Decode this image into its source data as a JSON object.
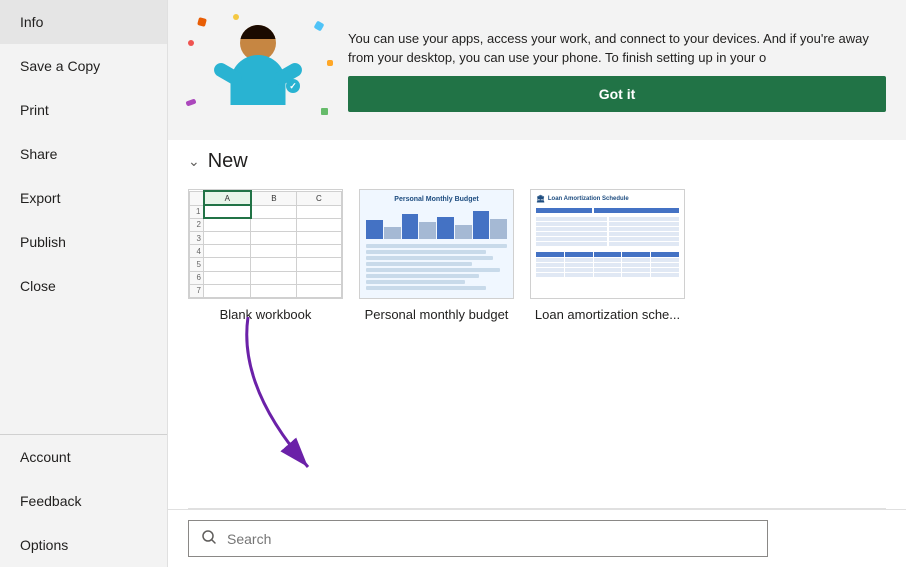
{
  "sidebar": {
    "items": [
      {
        "id": "info",
        "label": "Info"
      },
      {
        "id": "save-copy",
        "label": "Save a Copy"
      },
      {
        "id": "print",
        "label": "Print"
      },
      {
        "id": "share",
        "label": "Share"
      },
      {
        "id": "export",
        "label": "Export"
      },
      {
        "id": "publish",
        "label": "Publish"
      },
      {
        "id": "close",
        "label": "Close"
      }
    ],
    "bottom_items": [
      {
        "id": "account",
        "label": "Account"
      },
      {
        "id": "feedback",
        "label": "Feedback"
      },
      {
        "id": "options",
        "label": "Options"
      }
    ]
  },
  "banner": {
    "text": "You can use your apps, access your work, and connect to your devices. And if you're away from your desktop, you can use your phone. To finish setting up in your o",
    "got_it_label": "Got it"
  },
  "new_section": {
    "header": "New",
    "templates": [
      {
        "id": "blank-workbook",
        "label": "Blank workbook"
      },
      {
        "id": "personal-monthly-budget",
        "label": "Personal monthly budget"
      },
      {
        "id": "loan-amortization",
        "label": "Loan amortization sche..."
      }
    ]
  },
  "search": {
    "placeholder": "Search",
    "icon": "search-icon"
  }
}
